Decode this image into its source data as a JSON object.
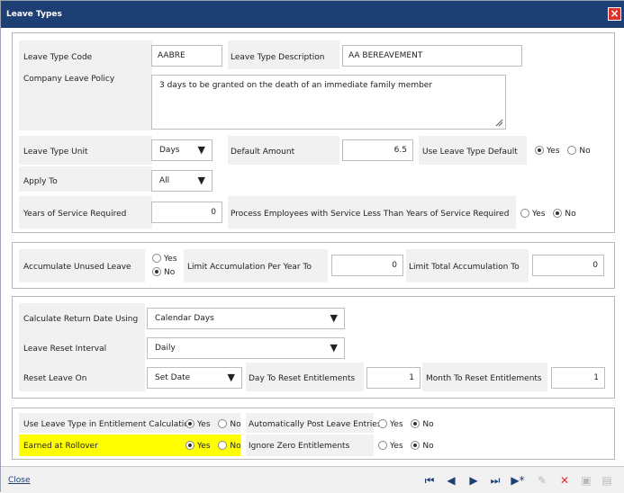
{
  "dialog": {
    "title": "Leave Types"
  },
  "section1": {
    "leave_type_code_label": "Leave Type Code",
    "leave_type_code_value": "AABRE",
    "leave_type_desc_label": "Leave Type Description",
    "leave_type_desc_value": "AA BEREAVEMENT",
    "company_policy_label": "Company Leave Policy",
    "company_policy_value": "3 days to be granted on the death of an immediate family member",
    "leave_type_unit_label": "Leave Type Unit",
    "leave_type_unit_value": "Days",
    "default_amount_label": "Default Amount",
    "default_amount_value": "6.5",
    "use_default_label": "Use Leave Type Default",
    "apply_to_label": "Apply To",
    "apply_to_value": "All",
    "years_service_label": "Years of Service Required",
    "years_service_value": "0",
    "process_less_label": "Process Employees with Service Less Than Years of Service Required"
  },
  "section2": {
    "accumulate_label": "Accumulate Unused Leave",
    "limit_year_label": "Limit Accumulation Per Year To",
    "limit_year_value": "0",
    "limit_total_label": "Limit Total Accumulation To",
    "limit_total_value": "0"
  },
  "section3": {
    "calc_return_label": "Calculate Return Date Using",
    "calc_return_value": "Calendar Days",
    "reset_interval_label": "Leave Reset Interval",
    "reset_interval_value": "Daily",
    "reset_on_label": "Reset Leave On",
    "reset_on_value": "Set Date",
    "day_reset_label": "Day To Reset Entitlements",
    "day_reset_value": "1",
    "month_reset_label": "Month To Reset Entitlements",
    "month_reset_value": "1"
  },
  "section4": {
    "use_in_calc_label": "Use Leave Type in Entitlement Calculation",
    "auto_post_label": "Automatically Post Leave Entries",
    "earned_rollover_label": "Earned at Rollover",
    "ignore_zero_label": "Ignore Zero Entitlements"
  },
  "radio": {
    "yes": "Yes",
    "no": "No"
  },
  "footer": {
    "close_label": "Close"
  },
  "colors": {
    "titlebar": "#1e3f74",
    "highlight": "#ffff00",
    "close_button": "#d9342b"
  },
  "icons": [
    "close-icon",
    "first-record-icon",
    "previous-record-icon",
    "next-record-icon",
    "last-record-icon",
    "new-record-icon",
    "edit-icon",
    "delete-icon",
    "save-icon",
    "save-as-icon"
  ]
}
